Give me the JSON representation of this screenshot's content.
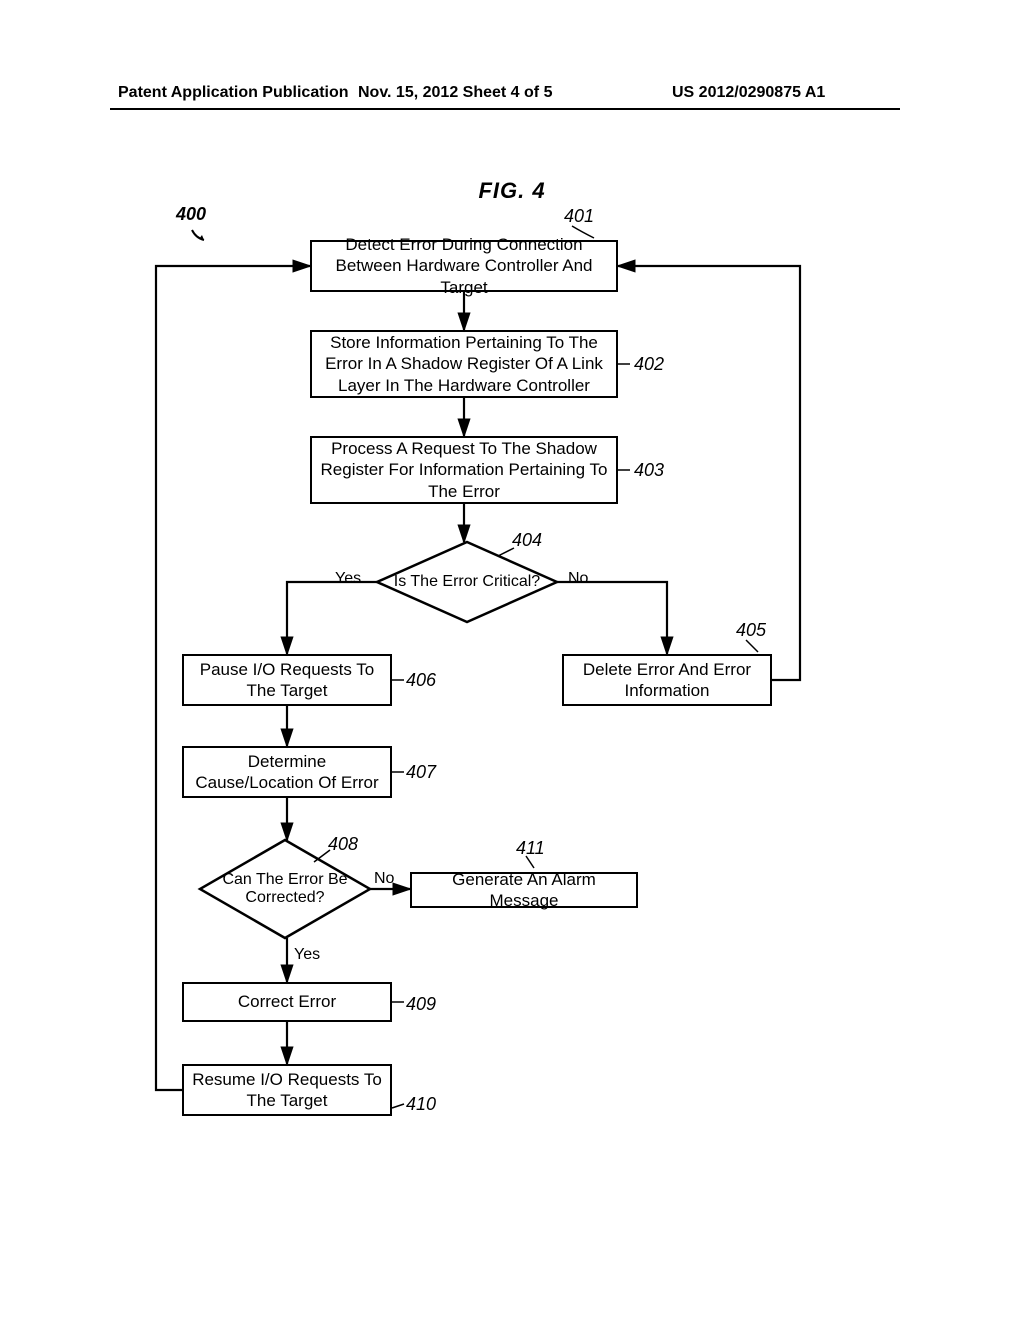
{
  "header": {
    "left": "Patent Application Publication",
    "center": "Nov. 15, 2012  Sheet 4 of 5",
    "right": "US 2012/0290875 A1"
  },
  "figure_title": "FIG. 4",
  "refs": {
    "r400": "400",
    "r401": "401",
    "r402": "402",
    "r403": "403",
    "r404": "404",
    "r405": "405",
    "r406": "406",
    "r407": "407",
    "r408": "408",
    "r409": "409",
    "r410": "410",
    "r411": "411"
  },
  "boxes": {
    "b401": "Detect Error During Connection Between Hardware Controller And Target",
    "b402": "Store Information Pertaining To The Error In A Shadow Register Of A Link Layer In The Hardware Controller",
    "b403": "Process A Request To The Shadow Register For Information Pertaining To The Error",
    "b405": "Delete Error And Error Information",
    "b406": "Pause I/O Requests To The Target",
    "b407": "Determine Cause/Location Of Error",
    "b409": "Correct Error",
    "b410": "Resume I/O Requests To The Target",
    "b411": "Generate An Alarm Message"
  },
  "diamonds": {
    "d404": "Is The Error Critical?",
    "d408": "Can The Error Be Corrected?"
  },
  "edge_labels": {
    "yes1": "Yes",
    "no1": "No",
    "yes2": "Yes",
    "no2": "No"
  }
}
